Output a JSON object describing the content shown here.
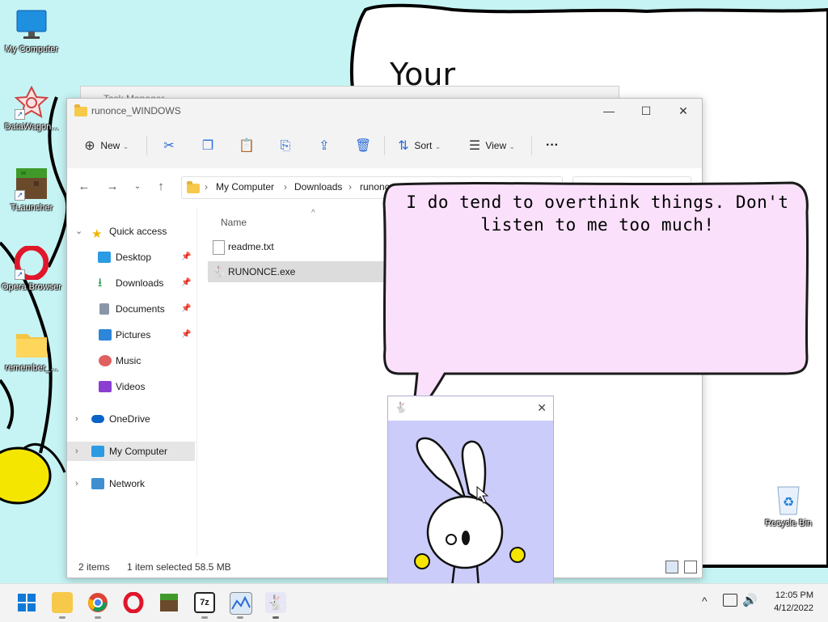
{
  "wallpaper": {
    "drawn_word": "Your"
  },
  "desktop_icons": [
    {
      "label": "My Computer",
      "icon": "monitor-icon"
    },
    {
      "label": "DataWagon...",
      "icon": "datawagon-icon"
    },
    {
      "label": "TLauncher",
      "icon": "tlauncher-icon"
    },
    {
      "label": "Opera Browser",
      "icon": "opera-icon"
    },
    {
      "label": "remember_...",
      "icon": "folder-icon"
    },
    {
      "label": "Recycle Bin",
      "icon": "recycle-bin-icon"
    }
  ],
  "task_manager": {
    "title": "Task Manager"
  },
  "explorer": {
    "title": "runonce_WINDOWS",
    "toolbar": {
      "new": "New",
      "sort": "Sort",
      "view": "View",
      "more": "···"
    },
    "breadcrumb": [
      "My Computer",
      "Downloads",
      "runonce_WINDOWS"
    ],
    "nav": {
      "quick_access": "Quick access",
      "desktop": "Desktop",
      "downloads": "Downloads",
      "documents": "Documents",
      "pictures": "Pictures",
      "music": "Music",
      "videos": "Videos",
      "onedrive": "OneDrive",
      "my_computer": "My Computer",
      "network": "Network"
    },
    "column_name": "Name",
    "files": [
      {
        "name": "readme.txt",
        "icon": "text-file-icon"
      },
      {
        "name": "RUNONCE.exe",
        "icon": "bunny-app-icon",
        "selected": true
      }
    ],
    "status": {
      "items": "2 items",
      "selected": "1 item selected",
      "size": "58.5 MB"
    }
  },
  "speech_bubble": {
    "text": "I do tend to overthink things. Don't listen to me too much!"
  },
  "taskbar": {
    "apps": [
      "start",
      "file-explorer",
      "chrome",
      "opera",
      "minecraft",
      "7zip",
      "datawagon",
      "runonce"
    ],
    "time": "12:05 PM",
    "date": "4/12/2022"
  },
  "colors": {
    "desktop_bg": "#c6f4f4",
    "bubble_fill": "#fbe0fb",
    "bunny_bg": "#ccccfa",
    "accent": "#0067c0"
  }
}
